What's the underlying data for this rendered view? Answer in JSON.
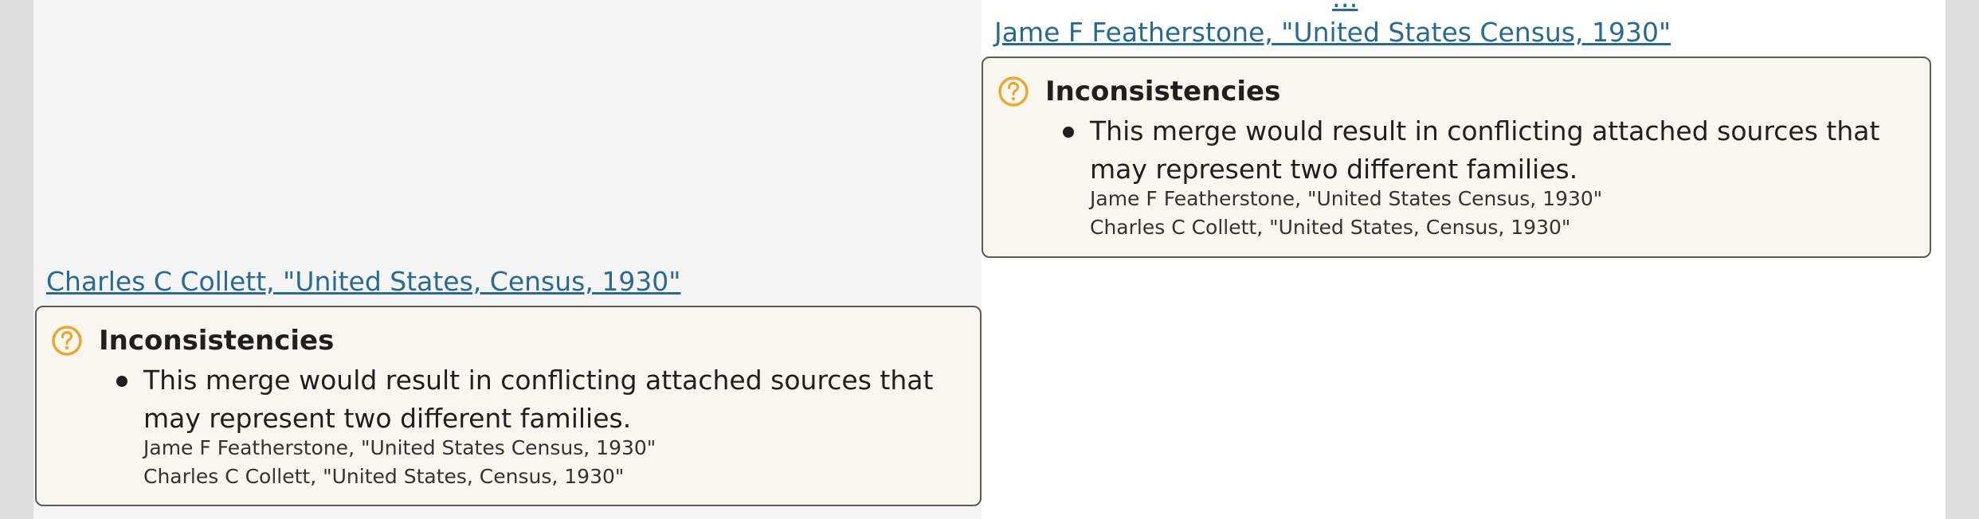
{
  "colors": {
    "link": "#2b6a8f",
    "card_background": "#f9f6ee",
    "warning_icon": "#e8a832"
  },
  "top_partial_text": "...",
  "left": {
    "link": "Charles C Collett, \"United States, Census, 1930\"",
    "card": {
      "icon": "question-circle-icon",
      "title": "Inconsistencies",
      "message": "This merge would result in conflicting attached sources that may represent two different families.",
      "sources": [
        "Jame F Featherstone, \"United States Census, 1930\"",
        "Charles C Collett, \"United States, Census, 1930\""
      ]
    }
  },
  "right": {
    "link": "Jame F Featherstone, \"United States Census, 1930\"",
    "card": {
      "icon": "question-circle-icon",
      "title": "Inconsistencies",
      "message": "This merge would result in conflicting attached sources that may represent two different families.",
      "sources": [
        "Jame F Featherstone, \"United States Census, 1930\"",
        "Charles C Collett, \"United States, Census, 1930\""
      ]
    }
  }
}
